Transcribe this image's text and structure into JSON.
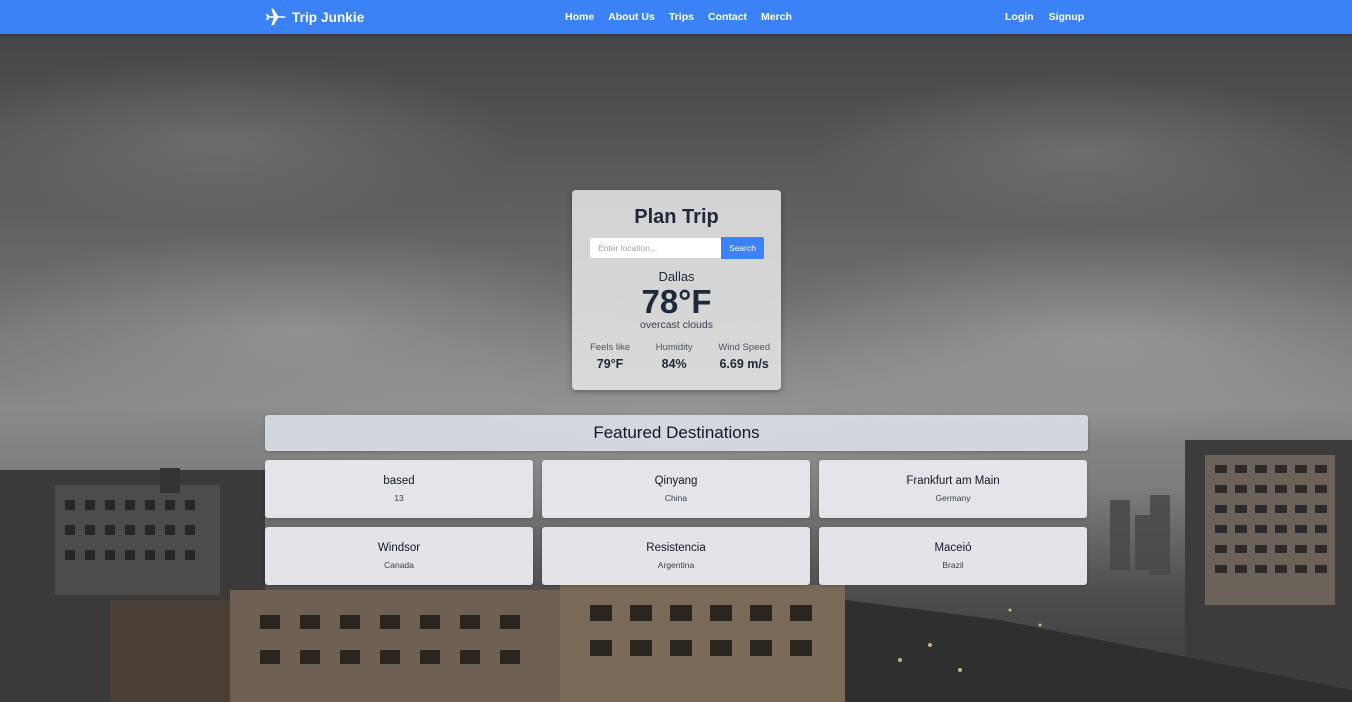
{
  "navbar": {
    "brand": "Trip Junkie",
    "links": [
      "Home",
      "About Us",
      "Trips",
      "Contact",
      "Merch"
    ],
    "auth": [
      "Login",
      "Signup"
    ]
  },
  "plan": {
    "title": "Plan Trip",
    "search_placeholder": "Enter location...",
    "search_button": "Search",
    "city": "Dallas",
    "temperature": "78°F",
    "description": "overcast clouds",
    "stats": [
      {
        "label": "Feels like",
        "value": "79°F"
      },
      {
        "label": "Humidity",
        "value": "84%"
      },
      {
        "label": "Wind Speed",
        "value": "6.69 m/s"
      }
    ]
  },
  "featured": {
    "title": "Featured Destinations",
    "destinations": [
      {
        "name": "based",
        "country": "13"
      },
      {
        "name": "Qinyang",
        "country": "China"
      },
      {
        "name": "Frankfurt am Main",
        "country": "Germany"
      },
      {
        "name": "Windsor",
        "country": "Canada"
      },
      {
        "name": "Resistencia",
        "country": "Argentina"
      },
      {
        "name": "Maceió",
        "country": "Brazil"
      }
    ]
  },
  "colors": {
    "navbar": "#3b82f6",
    "button": "#3b82f6"
  },
  "icons": {
    "brand": "airplane-icon"
  }
}
